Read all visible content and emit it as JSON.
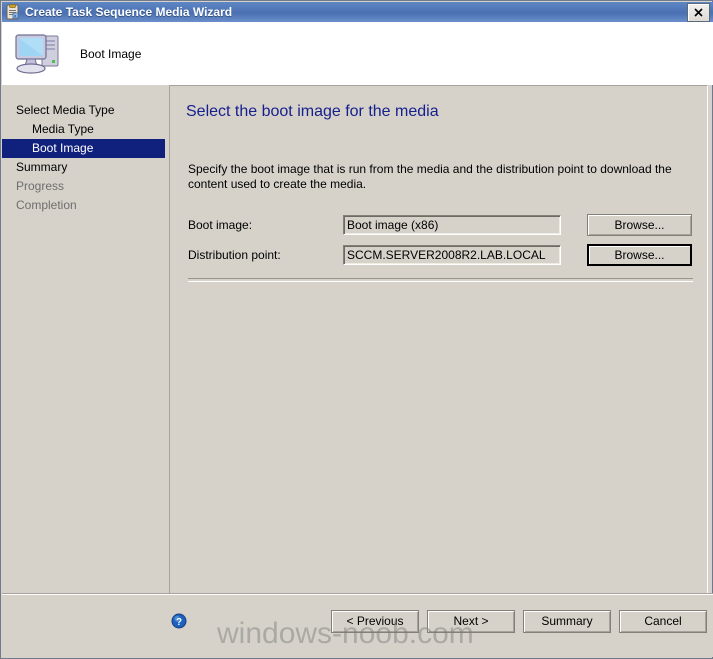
{
  "window": {
    "title": "Create Task Sequence Media Wizard",
    "title_icon": "task-sequence-icon",
    "close_label": "Close"
  },
  "header": {
    "title": "Boot Image",
    "icon": "computer-icon"
  },
  "sidebar": {
    "items": [
      {
        "label": "Select Media Type",
        "level": 0,
        "state": "normal"
      },
      {
        "label": "Media Type",
        "level": 1,
        "state": "normal"
      },
      {
        "label": "Boot Image",
        "level": 1,
        "state": "selected"
      },
      {
        "label": "Summary",
        "level": 0,
        "state": "normal"
      },
      {
        "label": "Progress",
        "level": 0,
        "state": "dim"
      },
      {
        "label": "Completion",
        "level": 0,
        "state": "dim"
      }
    ]
  },
  "content": {
    "heading": "Select the boot image for the media",
    "description": "Specify the boot image that is run from the media and the distribution point to download the content used to create the media.",
    "fields": [
      {
        "label": "Boot image:",
        "value": "Boot image (x86)",
        "button_label": "Browse...",
        "focused": false
      },
      {
        "label": "Distribution point:",
        "value": "SCCM.SERVER2008R2.LAB.LOCAL",
        "button_label": "Browse...",
        "focused": true
      }
    ]
  },
  "footer": {
    "help_icon": "help-icon",
    "buttons": [
      {
        "label": "< Previous"
      },
      {
        "label": "Next >"
      },
      {
        "label": "Summary"
      },
      {
        "label": "Cancel"
      }
    ]
  },
  "watermark": {
    "text": "windows-noob.com"
  },
  "colors": {
    "titlebar_blue": "#4e74b5",
    "selection_navy": "#10217d",
    "heading_blue": "#16208c",
    "window_face": "#d6d2ca"
  }
}
